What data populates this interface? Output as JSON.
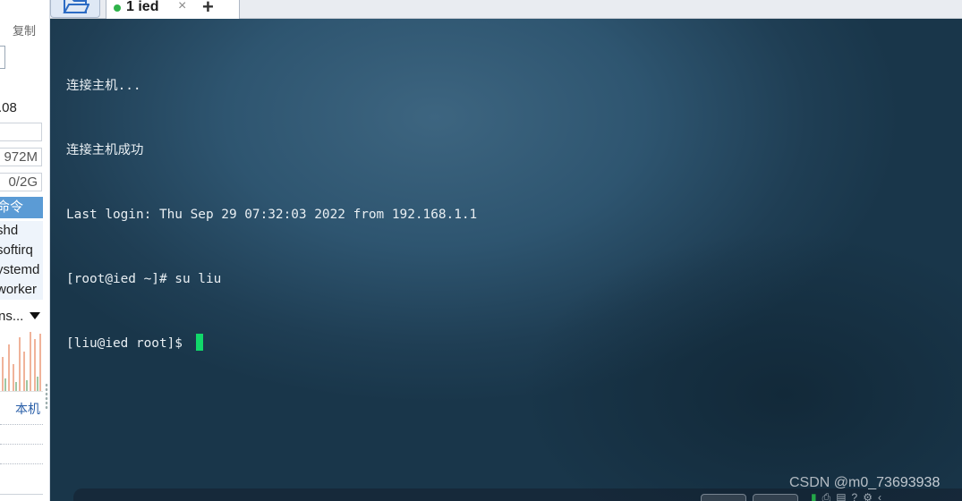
{
  "sidebar": {
    "copy_label": "复制",
    "load_value": ".08",
    "mem_value": "972M",
    "swap_value": "0/2G",
    "process_header": "命令",
    "processes": [
      "shd",
      "softirq",
      "ystemd",
      "worker"
    ],
    "network_dropdown": "ns...",
    "local_label": "本机"
  },
  "tabbar": {
    "tab_label": "1 ied",
    "tab_close": "×",
    "add_tab": "+"
  },
  "terminal": {
    "lines": [
      "连接主机...",
      "连接主机成功",
      "Last login: Thu Sep 29 07:32:03 2022 from 192.168.1.1",
      "[root@ied ~]# su liu",
      "[liu@ied root]$ "
    ],
    "cursor_color": "#11d86a",
    "text_color": "#e8eef2"
  },
  "watermark": "CSDN @m0_73693938",
  "colors": {
    "tab_status_dot": "#2fb34a",
    "process_header_bg": "#5b9bd5",
    "local_link": "#2a5fa8"
  }
}
